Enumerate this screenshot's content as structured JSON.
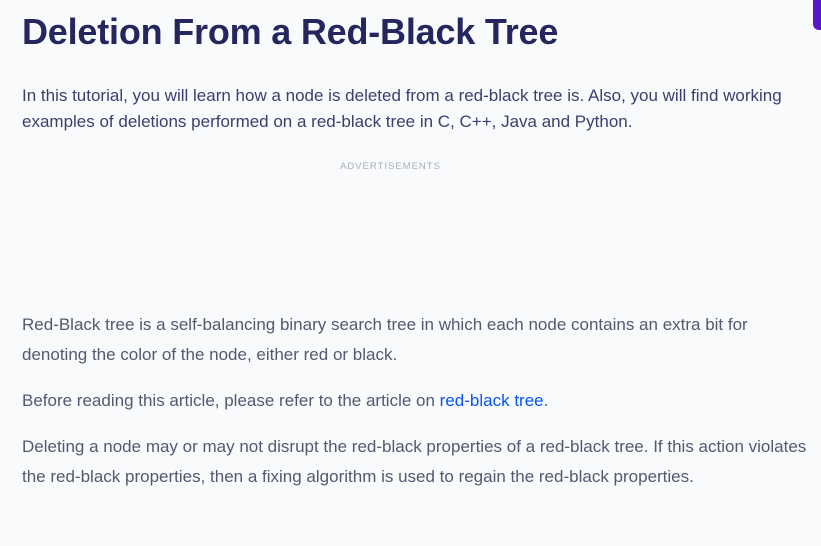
{
  "article": {
    "title": "Deletion From a Red-Black Tree",
    "intro": "In this tutorial, you will learn how a node is deleted from a red-black tree is. Also, you will find working examples of deletions performed on a red-black tree in C, C++, Java and Python.",
    "ad_label": "ADVERTISEMENTS",
    "paragraphs": {
      "p1": "Red-Black tree is a self-balancing binary search tree in which each node contains an extra bit for denoting the color of the node, either red or black.",
      "p2_before": "Before reading this article, please refer to the article on ",
      "p2_link": "red-black tree",
      "p2_after": ".",
      "p3": "Deleting a node may or may not disrupt the red-black properties of a red-black tree. If this action violates the red-black properties, then a fixing algorithm is used to regain the red-black properties."
    }
  },
  "colors": {
    "background": "#f9fafc",
    "title": "#25265e",
    "intro_text": "#3c3e6e",
    "body_text": "#545871",
    "link": "#0556f3",
    "accent": "#5a17c9"
  }
}
